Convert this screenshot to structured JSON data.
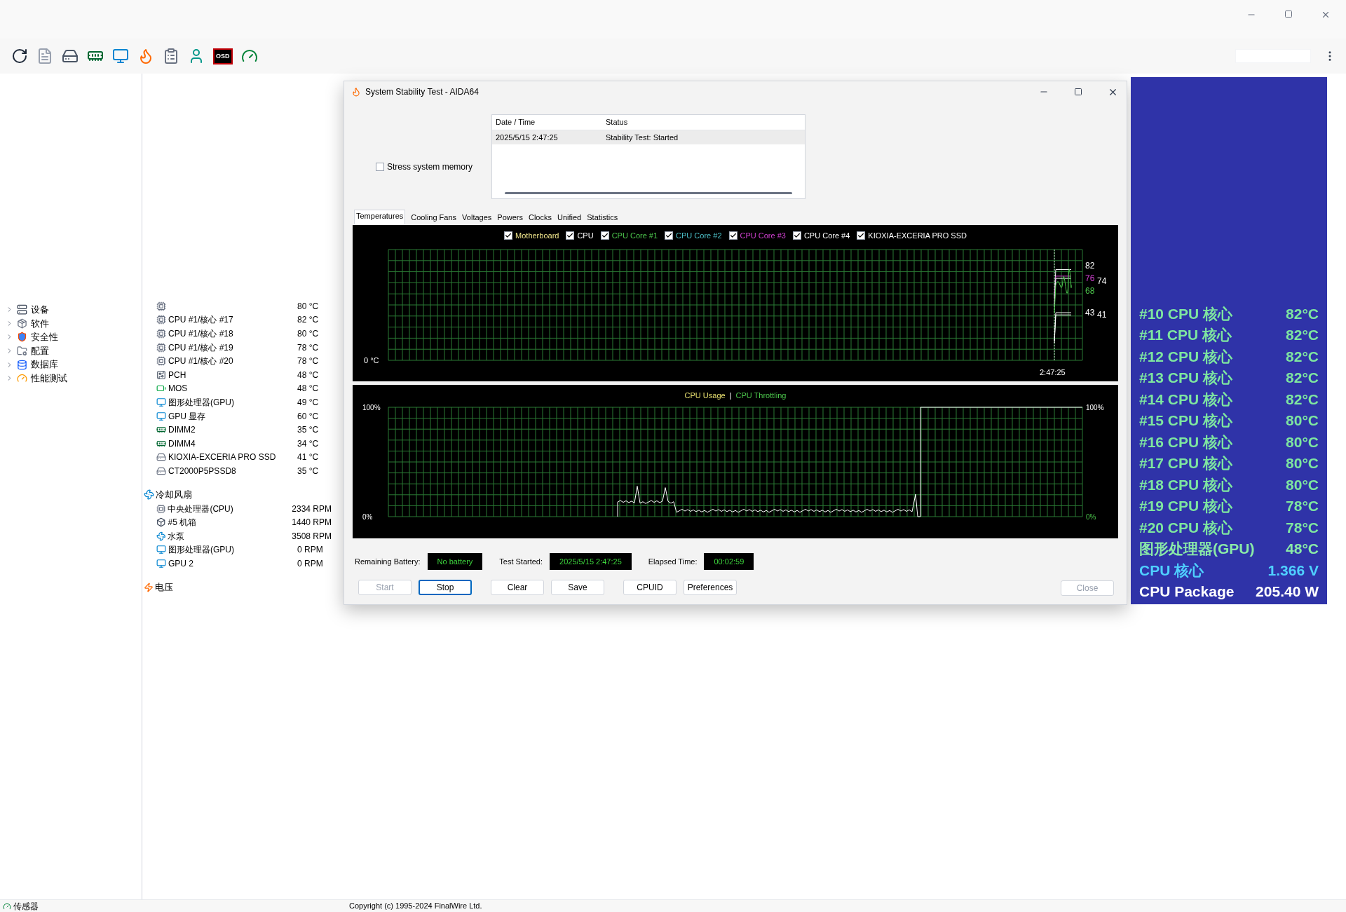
{
  "toolbar": [
    {
      "kind": "refresh"
    },
    {
      "kind": "report"
    },
    {
      "kind": "drive"
    },
    {
      "kind": "memory"
    },
    {
      "kind": "display"
    },
    {
      "kind": "flame"
    },
    {
      "kind": "checklist"
    },
    {
      "kind": "user"
    },
    {
      "kind": "osd",
      "label": "OSD"
    },
    {
      "kind": "gauge"
    }
  ],
  "tree": [
    {
      "label": "设备",
      "kind": "device",
      "expanded": false
    },
    {
      "label": "软件",
      "kind": "software",
      "expanded": false
    },
    {
      "label": "安全性",
      "kind": "security",
      "expanded": false
    },
    {
      "label": "配置",
      "kind": "config",
      "expanded": false
    },
    {
      "label": "数据库",
      "kind": "database",
      "expanded": false
    },
    {
      "label": "性能测试",
      "kind": "benchmark",
      "expanded": false
    }
  ],
  "sensor_sections": [
    {
      "kind": "temperature",
      "rows": [
        {
          "kind": "cpu",
          "value": "80 °C"
        },
        {
          "kind": "cpu",
          "name": "CPU #1/核心 #17",
          "value": "82 °C"
        },
        {
          "kind": "cpu",
          "name": "CPU #1/核心 #18",
          "value": "80 °C"
        },
        {
          "kind": "cpu",
          "name": "CPU #1/核心 #19",
          "value": "78 °C"
        },
        {
          "kind": "cpu",
          "name": "CPU #1/核心 #20",
          "value": "78 °C"
        },
        {
          "kind": "chipset",
          "name": "PCH",
          "value": "48 °C"
        },
        {
          "kind": "mos",
          "name": "MOS",
          "value": "48 °C"
        },
        {
          "kind": "gpu",
          "name": "图形处理器(GPU)",
          "value": "49 °C"
        },
        {
          "kind": "gpu",
          "name": "GPU 显存",
          "value": "60 °C"
        },
        {
          "kind": "memory",
          "name": "DIMM2",
          "value": "35 °C"
        },
        {
          "kind": "memory",
          "name": "DIMM4",
          "value": "34 °C"
        },
        {
          "kind": "drive",
          "name": "KIOXIA-EXCERIA PRO SSD",
          "value": "41 °C"
        },
        {
          "kind": "drive",
          "name": "CT2000P5PSSD8",
          "value": "35 °C"
        }
      ]
    },
    {
      "kind": "fan",
      "title": "冷却风扇",
      "rows": [
        {
          "kind": "cpu",
          "name": "中央处理器(CPU)",
          "value": "2334 RPM"
        },
        {
          "kind": "case",
          "name": "#5 机箱",
          "value": "1440 RPM"
        },
        {
          "kind": "fan",
          "name": "水泵",
          "value": "3508 RPM"
        },
        {
          "kind": "gpu",
          "name": "图形处理器(GPU)",
          "value": "0 RPM"
        },
        {
          "kind": "gpu",
          "name": "GPU 2",
          "value": "0 RPM"
        }
      ]
    },
    {
      "kind": "voltage",
      "title": "电压"
    }
  ],
  "stability": {
    "title": "System Stability Test - AIDA64",
    "options": [
      {
        "label": "Stress system memory",
        "checked": false
      }
    ],
    "log": {
      "columns": [
        "Date / Time",
        "Status"
      ],
      "rows": [
        {
          "cells": [
            "2025/5/15 2:47:25",
            "Stability Test: Started"
          ],
          "selected": true
        }
      ]
    },
    "tabs": [
      {
        "label": "Temperatures",
        "selected": true
      },
      {
        "label": "Cooling Fans",
        "selected": false
      },
      {
        "label": "Voltages",
        "selected": false
      },
      {
        "label": "Powers",
        "selected": false
      },
      {
        "label": "Clocks",
        "selected": false
      },
      {
        "label": "Unified",
        "selected": false
      },
      {
        "label": "Statistics",
        "selected": false
      }
    ],
    "temp_chart": {
      "legend": [
        {
          "label": "Motherboard",
          "checked": true,
          "color": "#f0e68c"
        },
        {
          "label": "CPU",
          "checked": true,
          "color": "#ffffff"
        },
        {
          "label": "CPU Core #1",
          "checked": true,
          "color": "#4cc64c"
        },
        {
          "label": "CPU Core #2",
          "checked": true,
          "color": "#4cc0c8"
        },
        {
          "label": "CPU Core #3",
          "checked": true,
          "color": "#d040d0"
        },
        {
          "label": "CPU Core #4",
          "checked": true,
          "color": "#ffffff"
        },
        {
          "label": "KIOXIA-EXCERIA PRO SSD",
          "checked": true,
          "color": "#ffffff"
        }
      ],
      "y_label": "0 °C",
      "time_label": "2:47:25",
      "end_labels": [
        {
          "text": "82",
          "color": "#ffffff"
        },
        {
          "text": "76",
          "color": "#d040d0"
        },
        {
          "text": "74",
          "color": "#ffffff"
        },
        {
          "text": "68",
          "color": "#4cc64c"
        },
        {
          "text": "43",
          "color": "#ffffff"
        },
        {
          "text": "41",
          "color": "#ffffff"
        }
      ]
    },
    "usage_chart": {
      "legend": [
        {
          "label": "CPU Usage",
          "color": "#e8e070"
        },
        {
          "label": "CPU Throttling",
          "color": "#4cc64c"
        }
      ],
      "separator": "|",
      "left_ticks": [
        "100%",
        "0%"
      ],
      "right_ticks": [
        "100%",
        "0%"
      ]
    },
    "info": [
      {
        "label": "Remaining Battery:",
        "value": "No battery"
      },
      {
        "label": "Test Started:",
        "value": "2025/5/15 2:47:25"
      },
      {
        "label": "Elapsed Time:",
        "value": "00:02:59"
      }
    ],
    "button_groups": [
      [
        {
          "label": "Start",
          "disabled": true,
          "default": false
        },
        {
          "label": "Stop",
          "disabled": false,
          "default": true
        }
      ],
      [
        {
          "label": "Clear",
          "disabled": false,
          "default": false
        },
        {
          "label": "Save",
          "disabled": false,
          "default": false
        }
      ],
      [
        {
          "label": "CPUID",
          "disabled": false,
          "default": false
        },
        {
          "label": "Preferences",
          "disabled": false,
          "default": false
        }
      ]
    ],
    "close_button": {
      "label": "Close",
      "disabled": true,
      "default": false
    }
  },
  "osd": [
    {
      "label": "#10 CPU 核心",
      "value": "82°C",
      "color": "#7ee6a0"
    },
    {
      "label": "#11 CPU 核心",
      "value": "82°C",
      "color": "#7ee6a0"
    },
    {
      "label": "#12 CPU 核心",
      "value": "82°C",
      "color": "#7ee6a0"
    },
    {
      "label": "#13 CPU 核心",
      "value": "82°C",
      "color": "#7ee6a0"
    },
    {
      "label": "#14 CPU 核心",
      "value": "82°C",
      "color": "#7ee6a0"
    },
    {
      "label": "#15 CPU 核心",
      "value": "80°C",
      "color": "#7ee6a0"
    },
    {
      "label": "#16 CPU 核心",
      "value": "80°C",
      "color": "#7ee6a0"
    },
    {
      "label": "#17 CPU 核心",
      "value": "80°C",
      "color": "#7ee6a0"
    },
    {
      "label": "#18 CPU 核心",
      "value": "80°C",
      "color": "#7ee6a0"
    },
    {
      "label": "#19 CPU 核心",
      "value": "78°C",
      "color": "#7ee6a0"
    },
    {
      "label": "#20 CPU 核心",
      "value": "78°C",
      "color": "#7ee6a0"
    },
    {
      "label": "图形处理器(GPU)",
      "value": "48°C",
      "color": "#8aeaa8"
    },
    {
      "label": "CPU 核心",
      "value": "1.366 V",
      "color": "#4fd0ff"
    },
    {
      "label": "CPU Package",
      "value": "205.40 W",
      "color": "#ffffff"
    }
  ],
  "status_bar": {
    "label": "传感器",
    "copyright": "Copyright (c) 1995-2024 FinalWire Ltd."
  }
}
